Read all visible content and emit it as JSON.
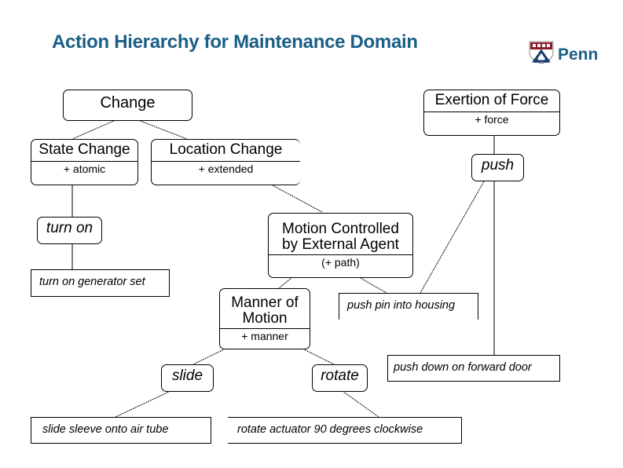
{
  "header": {
    "title": "Action Hierarchy for Maintenance Domain",
    "brand": "Penn",
    "logo_icon": "penn-shield-icon",
    "colors": {
      "title": "#1a5f86",
      "shield_top": "#8b1a2b",
      "shield_bottom": "#1a3d6b"
    }
  },
  "nodes": {
    "change": {
      "label": "Change"
    },
    "state_change": {
      "label": "State Change",
      "attr": "+ atomic"
    },
    "location_change": {
      "label": "Location Change",
      "attr": "+ extended"
    },
    "exertion_of_force": {
      "label": "Exertion of Force",
      "attr": "+ force"
    },
    "push": {
      "label": "push"
    },
    "turn_on": {
      "label": "turn on"
    },
    "motion_controlled": {
      "label": "Motion Controlled",
      "label2": "by External Agent",
      "attr": "(+ path)"
    },
    "manner_of_motion": {
      "label": "Manner of",
      "label2": "Motion",
      "attr": "+ manner"
    },
    "slide": {
      "label": "slide"
    },
    "rotate": {
      "label": "rotate"
    }
  },
  "leaves": {
    "turn_on_generator": "turn on generator set",
    "push_pin": "push pin into housing",
    "push_down": "push down on forward door",
    "slide_sleeve": "slide sleeve onto air tube",
    "rotate_actuator": "rotate actuator 90 degrees clockwise"
  },
  "edges": [
    [
      "change",
      "state_change"
    ],
    [
      "change",
      "location_change"
    ],
    [
      "state_change",
      "turn_on"
    ],
    [
      "turn_on",
      "turn_on_generator"
    ],
    [
      "location_change",
      "motion_controlled"
    ],
    [
      "exertion_of_force",
      "push"
    ],
    [
      "push",
      "push_pin"
    ],
    [
      "push",
      "push_down"
    ],
    [
      "motion_controlled",
      "manner_of_motion"
    ],
    [
      "motion_controlled",
      "push_pin"
    ],
    [
      "manner_of_motion",
      "slide"
    ],
    [
      "manner_of_motion",
      "rotate"
    ],
    [
      "slide",
      "slide_sleeve"
    ],
    [
      "rotate",
      "rotate_actuator"
    ]
  ]
}
